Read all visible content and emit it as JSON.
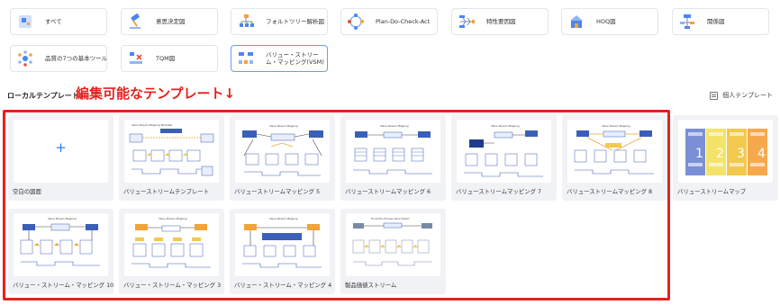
{
  "categories": [
    {
      "label": "すべて",
      "icon": "all-icon"
    },
    {
      "label": "意思決定図",
      "icon": "gavel-icon"
    },
    {
      "label": "フォルトツリー解析図",
      "icon": "fault-tree-icon"
    },
    {
      "label": "Plan-Do-Check-Act",
      "icon": "pdca-icon"
    },
    {
      "label": "特性要因図",
      "icon": "fishbone-icon"
    },
    {
      "label": "HOQ図",
      "icon": "house-of-quality-icon"
    },
    {
      "label": "関係図",
      "icon": "relation-icon"
    },
    {
      "label": "品質の7つの基本ツール",
      "icon": "seven-tools-icon"
    },
    {
      "label": "TQM図",
      "icon": "tqm-icon"
    },
    {
      "label": "バリュー・ストリーム・マッピング(VSM)",
      "icon": "vsm-icon"
    }
  ],
  "section_label": "ローカルテンプレート",
  "annotation": "編集可能なテンプレート↓",
  "personal_templates_label": "個人テンプレート",
  "colors": {
    "accent": "#2f7cf6",
    "highlight": "#e5211f"
  },
  "templates": [
    {
      "caption": "空白の図面",
      "icon": "plus-icon",
      "glyph": "+"
    },
    {
      "caption": "バリューストリームテンプレート",
      "thumb_title": "Value Stream Mapping Template"
    },
    {
      "caption": "バリューストリームマッピング 5",
      "thumb_title": "Value Stream Mapping"
    },
    {
      "caption": "バリューストリームマッピング 6",
      "thumb_title": "Value Stream Mapping"
    },
    {
      "caption": "バリューストリームマッピング 7",
      "thumb_title": "Value Stream Mapping"
    },
    {
      "caption": "バリューストリームマッピング 8",
      "thumb_title": "Value Stream Mapping"
    },
    {
      "caption": "バリューストリームマップ",
      "thumb_numbers": [
        "1",
        "2",
        "3",
        "4"
      ]
    },
    {
      "caption": "バリュー・ストリーム・マッピング 10",
      "thumb_title": "Value Stream Mapping"
    },
    {
      "caption": "バリュー・ストリーム・マッピング 3",
      "thumb_title": "Value Stream Mapping"
    },
    {
      "caption": "バリュー・ストリーム・マッピング 4",
      "thumb_title": "Value Stream Mapping"
    },
    {
      "caption": "製品価値ストリーム",
      "thumb_title": "Production Process Value Stream"
    }
  ]
}
